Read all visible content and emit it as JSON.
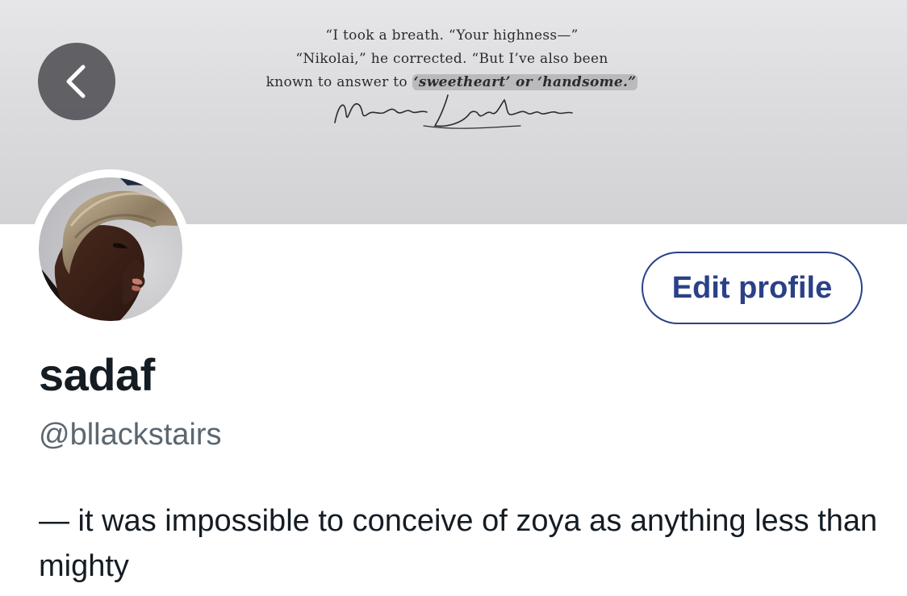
{
  "banner": {
    "quote_lines": [
      "“I took a breath. “Your highness—”",
      "“Nikolai,” he corrected. “But I’ve also been",
      "known to answer to "
    ],
    "quote_highlight": "‘sweetheart’ or ‘handsome.”",
    "signature": "Nikolai Lantsov"
  },
  "navigation": {
    "back_icon": "chevron-left-icon"
  },
  "profile": {
    "display_name": "sadaf",
    "handle": "@bllackstairs",
    "bio": "— it was impossible to conceive of zoya as anything less than mighty",
    "edit_profile_label": "Edit profile"
  },
  "colors": {
    "accent": "#2a4187",
    "name_text": "#141c24",
    "handle_text": "#5b6670",
    "banner_bg": "#dcdcde",
    "back_button_bg": "#55555a"
  }
}
